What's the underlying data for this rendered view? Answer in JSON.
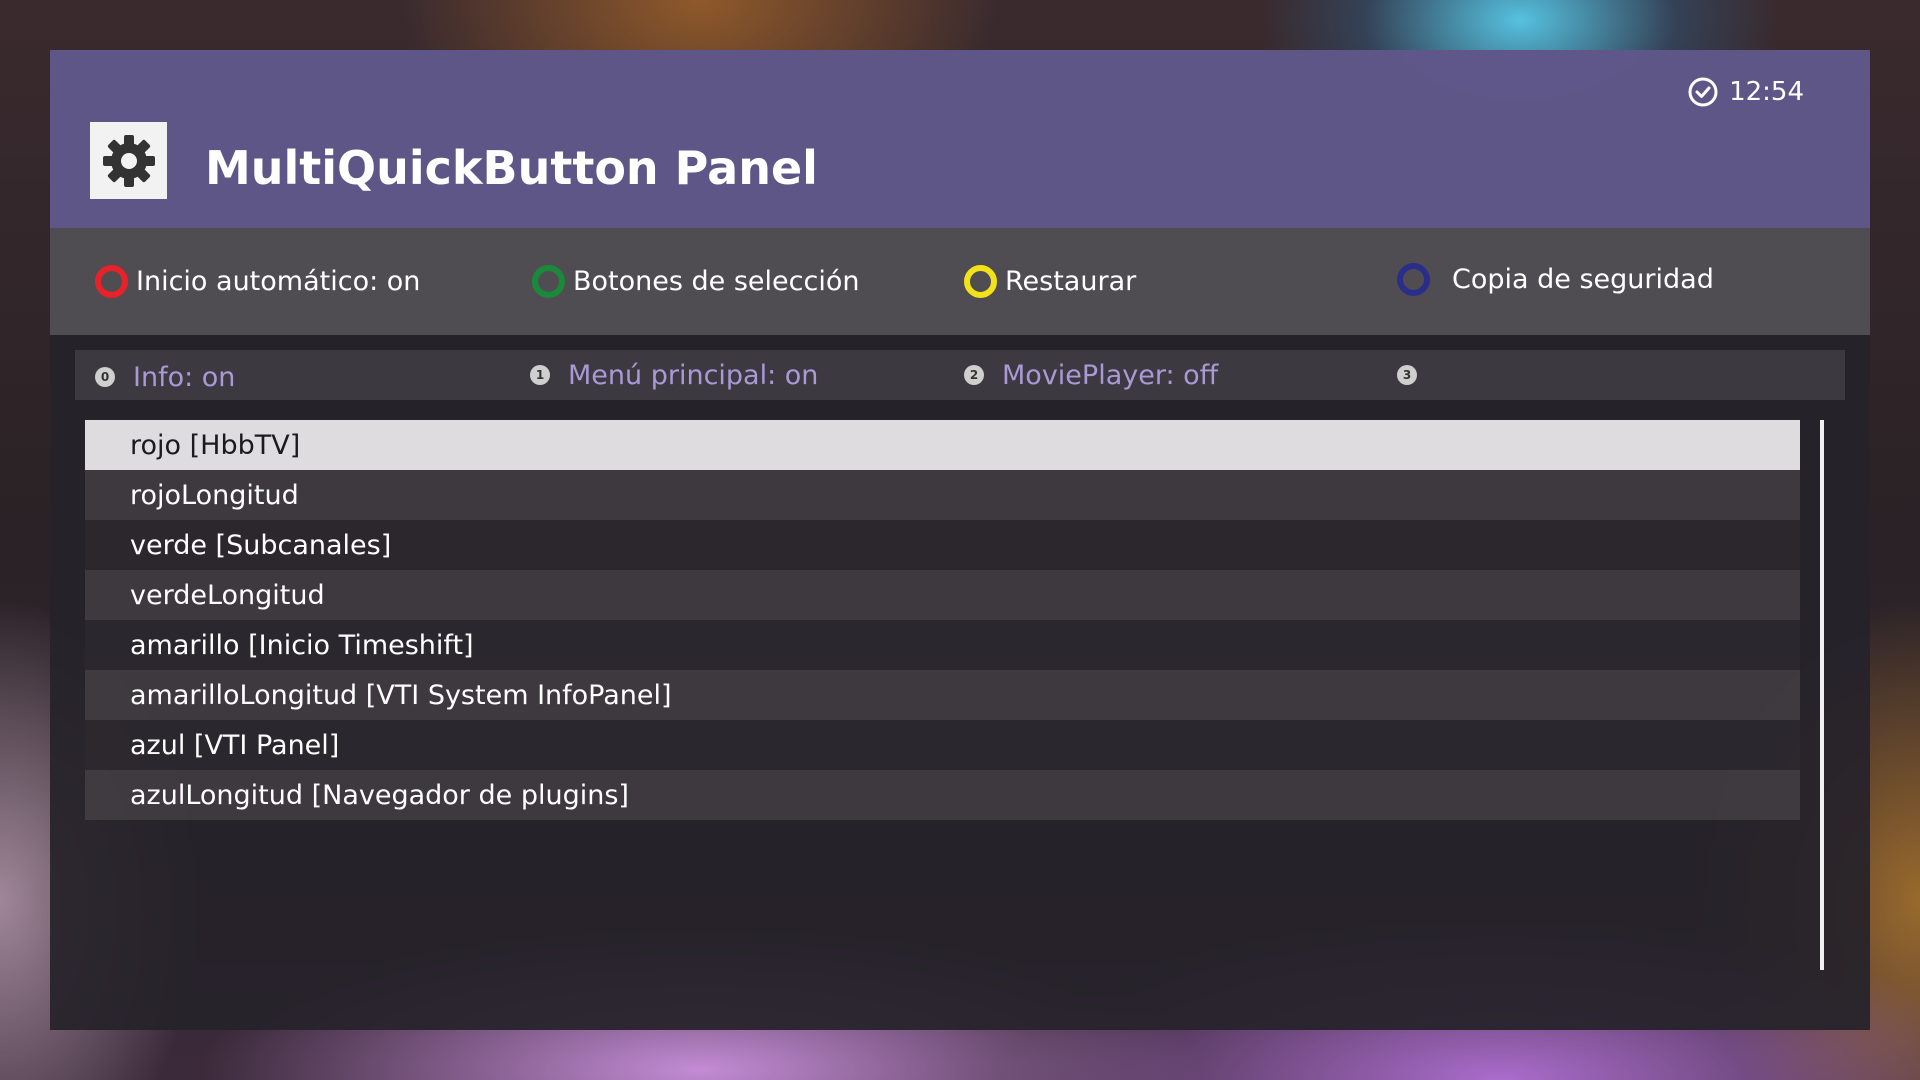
{
  "header": {
    "title": "MultiQuickButton Panel",
    "clock": "12:54",
    "app_icon": "gear-icon",
    "accent": "#62588c"
  },
  "color_buttons": [
    {
      "label": "Inicio automático: on",
      "color": "#e8222a",
      "icon": "red-button-icon"
    },
    {
      "label": "Botones de selección",
      "color": "#1a8a3a",
      "icon": "green-button-icon"
    },
    {
      "label": "Restaurar",
      "color": "#f2e21a",
      "icon": "yellow-button-icon"
    },
    {
      "label": "Copia de seguridad",
      "color": "#2a2e8a",
      "icon": "blue-button-icon"
    }
  ],
  "number_buttons": [
    {
      "key": "0",
      "label": "Info: on"
    },
    {
      "key": "1",
      "label": "Menú principal: on"
    },
    {
      "key": "2",
      "label": "MoviePlayer: off"
    },
    {
      "key": "3",
      "label": ""
    }
  ],
  "list": {
    "selected_index": 0,
    "items": [
      "rojo [HbbTV]",
      "rojoLongitud",
      "verde [Subcanales]",
      "verdeLongitud",
      "amarillo [Inicio Timeshift]",
      "amarilloLongitud [VTI System InfoPanel]",
      "azul [VTI Panel]",
      "azulLongitud [Navegador de plugins]"
    ]
  }
}
